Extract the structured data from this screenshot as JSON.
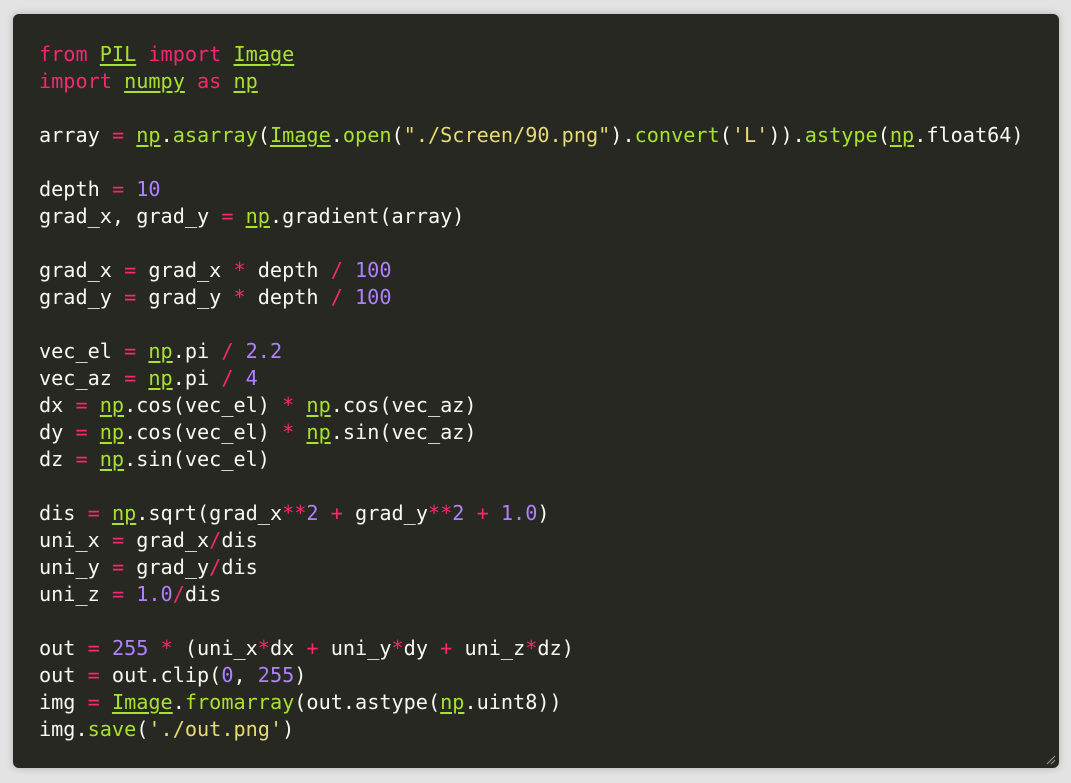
{
  "code_lines": [
    [
      {
        "t": "kw",
        "s": "from"
      },
      {
        "t": "plain",
        "s": " "
      },
      {
        "t": "mod",
        "s": "PIL"
      },
      {
        "t": "plain",
        "s": " "
      },
      {
        "t": "kw",
        "s": "import"
      },
      {
        "t": "plain",
        "s": " "
      },
      {
        "t": "mod",
        "s": "Image"
      }
    ],
    [
      {
        "t": "kw",
        "s": "import"
      },
      {
        "t": "plain",
        "s": " "
      },
      {
        "t": "mod",
        "s": "numpy"
      },
      {
        "t": "plain",
        "s": " "
      },
      {
        "t": "kw",
        "s": "as"
      },
      {
        "t": "plain",
        "s": " "
      },
      {
        "t": "mod",
        "s": "np"
      }
    ],
    [],
    [
      {
        "t": "plain",
        "s": "array "
      },
      {
        "t": "op",
        "s": "="
      },
      {
        "t": "plain",
        "s": " "
      },
      {
        "t": "mod",
        "s": "np"
      },
      {
        "t": "plain",
        "s": "."
      },
      {
        "t": "fn",
        "s": "asarray"
      },
      {
        "t": "plain",
        "s": "("
      },
      {
        "t": "mod",
        "s": "Image"
      },
      {
        "t": "plain",
        "s": "."
      },
      {
        "t": "fn",
        "s": "open"
      },
      {
        "t": "plain",
        "s": "("
      },
      {
        "t": "str",
        "s": "\"./Screen/90.png\""
      },
      {
        "t": "plain",
        "s": ")."
      },
      {
        "t": "fn",
        "s": "convert"
      },
      {
        "t": "plain",
        "s": "("
      },
      {
        "t": "str",
        "s": "'L'"
      },
      {
        "t": "plain",
        "s": "))."
      },
      {
        "t": "fn",
        "s": "astype"
      },
      {
        "t": "plain",
        "s": "("
      },
      {
        "t": "mod",
        "s": "np"
      },
      {
        "t": "plain",
        "s": ".float64)"
      }
    ],
    [],
    [
      {
        "t": "plain",
        "s": "depth "
      },
      {
        "t": "op",
        "s": "="
      },
      {
        "t": "plain",
        "s": " "
      },
      {
        "t": "num",
        "s": "10"
      }
    ],
    [
      {
        "t": "plain",
        "s": "grad_x, grad_y "
      },
      {
        "t": "op",
        "s": "="
      },
      {
        "t": "plain",
        "s": " "
      },
      {
        "t": "mod",
        "s": "np"
      },
      {
        "t": "plain",
        "s": ".gradient(array)"
      }
    ],
    [],
    [
      {
        "t": "plain",
        "s": "grad_x "
      },
      {
        "t": "op",
        "s": "="
      },
      {
        "t": "plain",
        "s": " grad_x "
      },
      {
        "t": "op",
        "s": "*"
      },
      {
        "t": "plain",
        "s": " depth "
      },
      {
        "t": "op",
        "s": "/"
      },
      {
        "t": "plain",
        "s": " "
      },
      {
        "t": "num",
        "s": "100"
      }
    ],
    [
      {
        "t": "plain",
        "s": "grad_y "
      },
      {
        "t": "op",
        "s": "="
      },
      {
        "t": "plain",
        "s": " grad_y "
      },
      {
        "t": "op",
        "s": "*"
      },
      {
        "t": "plain",
        "s": " depth "
      },
      {
        "t": "op",
        "s": "/"
      },
      {
        "t": "plain",
        "s": " "
      },
      {
        "t": "num",
        "s": "100"
      }
    ],
    [],
    [
      {
        "t": "plain",
        "s": "vec_el "
      },
      {
        "t": "op",
        "s": "="
      },
      {
        "t": "plain",
        "s": " "
      },
      {
        "t": "mod",
        "s": "np"
      },
      {
        "t": "plain",
        "s": ".pi "
      },
      {
        "t": "op",
        "s": "/"
      },
      {
        "t": "plain",
        "s": " "
      },
      {
        "t": "num",
        "s": "2.2"
      }
    ],
    [
      {
        "t": "plain",
        "s": "vec_az "
      },
      {
        "t": "op",
        "s": "="
      },
      {
        "t": "plain",
        "s": " "
      },
      {
        "t": "mod",
        "s": "np"
      },
      {
        "t": "plain",
        "s": ".pi "
      },
      {
        "t": "op",
        "s": "/"
      },
      {
        "t": "plain",
        "s": " "
      },
      {
        "t": "num",
        "s": "4"
      }
    ],
    [
      {
        "t": "plain",
        "s": "dx "
      },
      {
        "t": "op",
        "s": "="
      },
      {
        "t": "plain",
        "s": " "
      },
      {
        "t": "mod",
        "s": "np"
      },
      {
        "t": "plain",
        "s": ".cos(vec_el) "
      },
      {
        "t": "op",
        "s": "*"
      },
      {
        "t": "plain",
        "s": " "
      },
      {
        "t": "mod",
        "s": "np"
      },
      {
        "t": "plain",
        "s": ".cos(vec_az)"
      }
    ],
    [
      {
        "t": "plain",
        "s": "dy "
      },
      {
        "t": "op",
        "s": "="
      },
      {
        "t": "plain",
        "s": " "
      },
      {
        "t": "mod",
        "s": "np"
      },
      {
        "t": "plain",
        "s": ".cos(vec_el) "
      },
      {
        "t": "op",
        "s": "*"
      },
      {
        "t": "plain",
        "s": " "
      },
      {
        "t": "mod",
        "s": "np"
      },
      {
        "t": "plain",
        "s": ".sin(vec_az)"
      }
    ],
    [
      {
        "t": "plain",
        "s": "dz "
      },
      {
        "t": "op",
        "s": "="
      },
      {
        "t": "plain",
        "s": " "
      },
      {
        "t": "mod",
        "s": "np"
      },
      {
        "t": "plain",
        "s": ".sin(vec_el)"
      }
    ],
    [],
    [
      {
        "t": "plain",
        "s": "dis "
      },
      {
        "t": "op",
        "s": "="
      },
      {
        "t": "plain",
        "s": " "
      },
      {
        "t": "mod",
        "s": "np"
      },
      {
        "t": "plain",
        "s": ".sqrt(grad_x"
      },
      {
        "t": "op",
        "s": "**"
      },
      {
        "t": "num",
        "s": "2"
      },
      {
        "t": "plain",
        "s": " "
      },
      {
        "t": "op",
        "s": "+"
      },
      {
        "t": "plain",
        "s": " grad_y"
      },
      {
        "t": "op",
        "s": "**"
      },
      {
        "t": "num",
        "s": "2"
      },
      {
        "t": "plain",
        "s": " "
      },
      {
        "t": "op",
        "s": "+"
      },
      {
        "t": "plain",
        "s": " "
      },
      {
        "t": "num",
        "s": "1.0"
      },
      {
        "t": "plain",
        "s": ")"
      }
    ],
    [
      {
        "t": "plain",
        "s": "uni_x "
      },
      {
        "t": "op",
        "s": "="
      },
      {
        "t": "plain",
        "s": " grad_x"
      },
      {
        "t": "op",
        "s": "/"
      },
      {
        "t": "plain",
        "s": "dis"
      }
    ],
    [
      {
        "t": "plain",
        "s": "uni_y "
      },
      {
        "t": "op",
        "s": "="
      },
      {
        "t": "plain",
        "s": " grad_y"
      },
      {
        "t": "op",
        "s": "/"
      },
      {
        "t": "plain",
        "s": "dis"
      }
    ],
    [
      {
        "t": "plain",
        "s": "uni_z "
      },
      {
        "t": "op",
        "s": "="
      },
      {
        "t": "plain",
        "s": " "
      },
      {
        "t": "num",
        "s": "1.0"
      },
      {
        "t": "op",
        "s": "/"
      },
      {
        "t": "plain",
        "s": "dis"
      }
    ],
    [],
    [
      {
        "t": "plain",
        "s": "out "
      },
      {
        "t": "op",
        "s": "="
      },
      {
        "t": "plain",
        "s": " "
      },
      {
        "t": "num",
        "s": "255"
      },
      {
        "t": "plain",
        "s": " "
      },
      {
        "t": "op",
        "s": "*"
      },
      {
        "t": "plain",
        "s": " (uni_x"
      },
      {
        "t": "op",
        "s": "*"
      },
      {
        "t": "plain",
        "s": "dx "
      },
      {
        "t": "op",
        "s": "+"
      },
      {
        "t": "plain",
        "s": " uni_y"
      },
      {
        "t": "op",
        "s": "*"
      },
      {
        "t": "plain",
        "s": "dy "
      },
      {
        "t": "op",
        "s": "+"
      },
      {
        "t": "plain",
        "s": " uni_z"
      },
      {
        "t": "op",
        "s": "*"
      },
      {
        "t": "plain",
        "s": "dz)"
      }
    ],
    [
      {
        "t": "plain",
        "s": "out "
      },
      {
        "t": "op",
        "s": "="
      },
      {
        "t": "plain",
        "s": " out.clip("
      },
      {
        "t": "num",
        "s": "0"
      },
      {
        "t": "plain",
        "s": ", "
      },
      {
        "t": "num",
        "s": "255"
      },
      {
        "t": "plain",
        "s": ")"
      }
    ],
    [
      {
        "t": "plain",
        "s": "img "
      },
      {
        "t": "op",
        "s": "="
      },
      {
        "t": "plain",
        "s": " "
      },
      {
        "t": "mod",
        "s": "Image"
      },
      {
        "t": "plain",
        "s": "."
      },
      {
        "t": "fn",
        "s": "fromarray"
      },
      {
        "t": "plain",
        "s": "(out.astype("
      },
      {
        "t": "mod",
        "s": "np"
      },
      {
        "t": "plain",
        "s": ".uint8))"
      }
    ],
    [
      {
        "t": "plain",
        "s": "img."
      },
      {
        "t": "fn",
        "s": "save"
      },
      {
        "t": "plain",
        "s": "("
      },
      {
        "t": "str",
        "s": "'./out.png'"
      },
      {
        "t": "plain",
        "s": ")"
      }
    ]
  ],
  "colors": {
    "background": "#272822",
    "keyword": "#f92672",
    "function": "#a6e22e",
    "string": "#e6db74",
    "number": "#ae81ff",
    "text": "#f8f8f2"
  },
  "icons": {
    "resize_grip": "resize-grip-icon"
  }
}
